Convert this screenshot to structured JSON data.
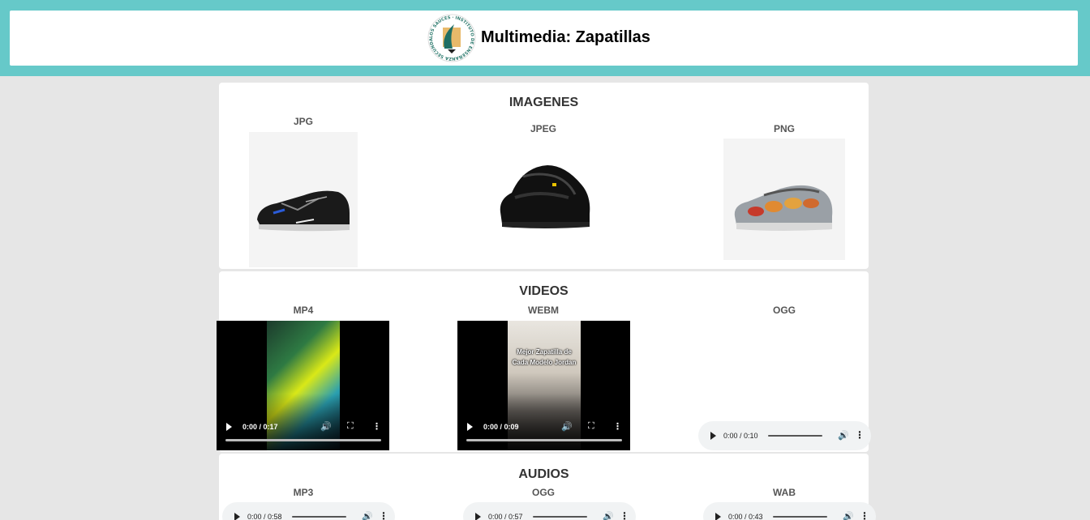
{
  "header": {
    "title": "Multimedia: Zapatillas",
    "logo_text": "LOS SAUCES · INSTITUTO DE ENSEÑANZA SECUNDARIA"
  },
  "images": {
    "title": "IMAGENES",
    "items": [
      {
        "label": "JPG",
        "icon": "black-blue-sneaker"
      },
      {
        "label": "JPEG",
        "icon": "black-sneaker"
      },
      {
        "label": "PNG",
        "icon": "grey-orange-sneaker"
      }
    ]
  },
  "videos": {
    "title": "VIDEOS",
    "items": [
      {
        "label": "MP4",
        "time": "0:00 / 0:17"
      },
      {
        "label": "WEBM",
        "time": "0:00 / 0:09",
        "overlay_text": "Mejor Zapatilla de Cada Modelo Jordan"
      },
      {
        "label": "OGG",
        "time": "0:00 / 0:10"
      }
    ]
  },
  "audios": {
    "title": "AUDIOS",
    "items": [
      {
        "label": "MP3",
        "time": "0:00 / 0:58"
      },
      {
        "label": "OGG",
        "time": "0:00 / 0:57"
      },
      {
        "label": "WAB",
        "time": "0:00 / 0:43"
      }
    ]
  },
  "colors": {
    "header_band": "#66c9c9",
    "page_bg": "#e6e6e6",
    "card_bg": "#ffffff"
  }
}
